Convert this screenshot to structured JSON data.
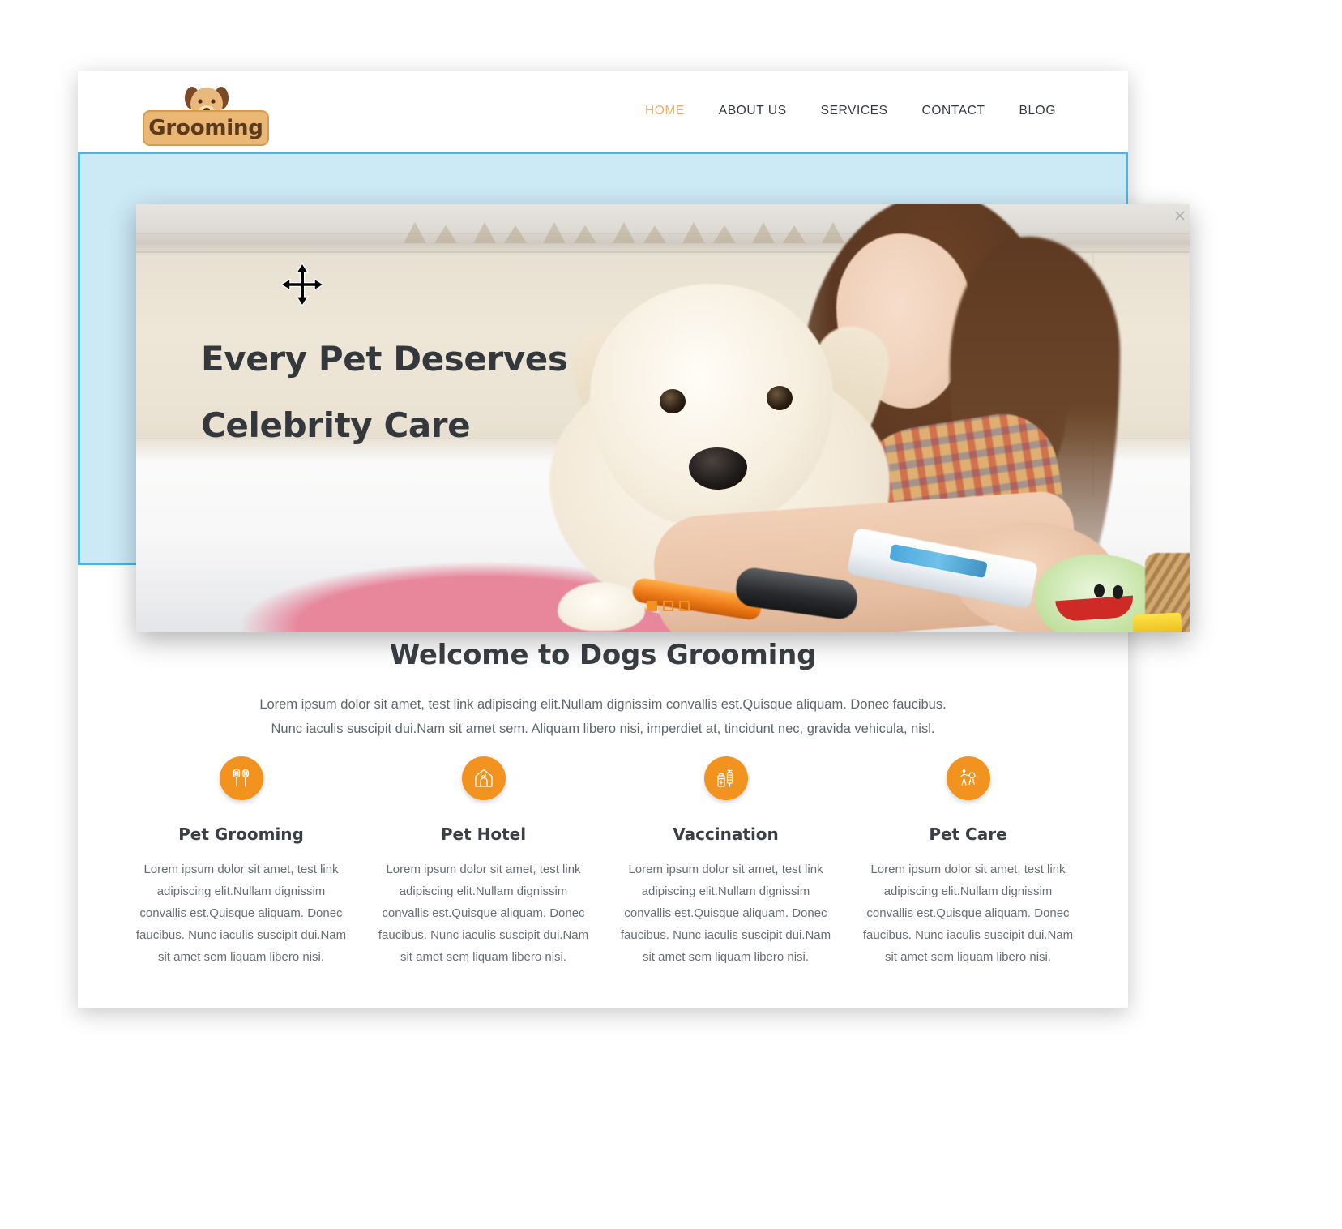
{
  "site": {
    "logo": {
      "text": "Grooming",
      "icon": "dog-face-icon",
      "plate_color": "#eab874",
      "plate_border": "#d79b4c",
      "text_color": "#5b3a1d"
    },
    "nav": {
      "items": [
        {
          "label": "HOME",
          "active": true
        },
        {
          "label": "ABOUT US",
          "active": false
        },
        {
          "label": "SERVICES",
          "active": false
        },
        {
          "label": "CONTACT",
          "active": false
        },
        {
          "label": "BLOG",
          "active": false
        }
      ],
      "active_color": "#e8b06a",
      "color": "#35393d"
    }
  },
  "blue_band": {
    "fill": "#cce9f6",
    "border": "#4fb3e2"
  },
  "hero": {
    "headline_line1": "Every Pet Deserves",
    "headline_line2": "Celebrity Care",
    "headline_color": "#34383c",
    "image_alt": "girl-grooming-puppy-photo",
    "slider": {
      "count": 3,
      "active_index": 0,
      "accent": "#f2931f"
    },
    "cursor": "move-cursor",
    "state": "dragging"
  },
  "welcome": {
    "title": "Welcome to Dogs Grooming",
    "paragraph": "Lorem ipsum dolor sit amet, test link adipiscing elit.Nullam dignissim convallis est.Quisque aliquam. Donec faucibus. Nunc iaculis suscipit dui.Nam sit amet sem. Aliquam libero nisi, imperdiet at, tincidunt nec, gravida vehicula, nisl."
  },
  "features": {
    "icon_bg": "#f2931f",
    "items": [
      {
        "icon": "grooming-brush-icon",
        "title": "Pet Grooming",
        "text": "Lorem ipsum dolor sit amet, test link adipiscing elit.Nullam dignissim convallis est.Quisque aliquam. Donec faucibus. Nunc iaculis suscipit dui.Nam sit amet sem liquam libero nisi."
      },
      {
        "icon": "dog-house-icon",
        "title": "Pet Hotel",
        "text": "Lorem ipsum dolor sit amet, test link adipiscing elit.Nullam dignissim convallis est.Quisque aliquam. Donec faucibus. Nunc iaculis suscipit dui.Nam sit amet sem liquam libero nisi."
      },
      {
        "icon": "syringe-vaccine-icon",
        "title": "Vaccination",
        "text": "Lorem ipsum dolor sit amet, test link adipiscing elit.Nullam dignissim convallis est.Quisque aliquam. Donec faucibus. Nunc iaculis suscipit dui.Nam sit amet sem liquam libero nisi."
      },
      {
        "icon": "person-walking-dog-icon",
        "title": "Pet Care",
        "text": "Lorem ipsum dolor sit amet, test link adipiscing elit.Nullam dignissim convallis est.Quisque aliquam. Donec faucibus. Nunc iaculis suscipit dui.Nam sit amet sem liquam libero nisi."
      }
    ]
  }
}
